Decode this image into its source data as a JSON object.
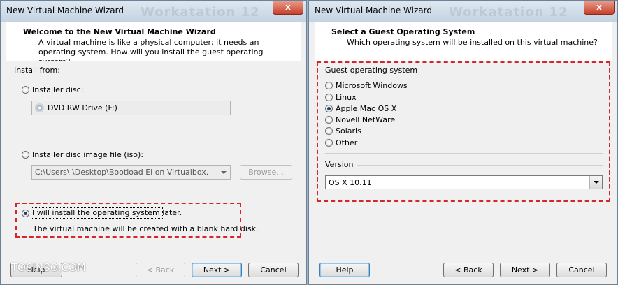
{
  "left_window": {
    "title": "New Virtual Machine Wizard",
    "ghost_title": "Workatation 12",
    "close_label": "x",
    "header": {
      "title": "Welcome to the New Virtual Machine Wizard",
      "subtitle": "A virtual machine is like a physical computer; it needs an operating system. How will you install the guest operating system?"
    },
    "install_from_label": "Install from:",
    "options": {
      "installer_disc": {
        "label": "Installer disc:",
        "checked": false
      },
      "disc_drive_value": "DVD RW Drive (F:)",
      "installer_image": {
        "label": "Installer disc image file (iso):",
        "checked": false
      },
      "iso_path_value": "C:\\Users\\          \\Desktop\\Bootload El on Virtualbox.",
      "browse_label": "Browse...",
      "install_later": {
        "label": "I will install the operating system later.",
        "checked": true
      },
      "install_later_desc": "The virtual machine will be created with a blank hard disk."
    },
    "footer": {
      "help_label": "Help",
      "back_label": "< Back",
      "next_label": "Next >",
      "cancel_label": "Cancel"
    }
  },
  "right_window": {
    "title": "New Virtual Machine Wizard",
    "ghost_title": "Workatation 12",
    "close_label": "x",
    "header": {
      "title": "Select a Guest Operating System",
      "subtitle": "Which operating system will be installed on this virtual machine?"
    },
    "group_label": "Guest operating system",
    "os_options": [
      {
        "label": "Microsoft Windows",
        "checked": false
      },
      {
        "label": "Linux",
        "checked": false
      },
      {
        "label": "Apple Mac OS X",
        "checked": true
      },
      {
        "label": "Novell NetWare",
        "checked": false
      },
      {
        "label": "Solaris",
        "checked": false
      },
      {
        "label": "Other",
        "checked": false
      }
    ],
    "version_label": "Version",
    "version_value": "OS X 10.11",
    "footer": {
      "help_label": "Help",
      "back_label": "< Back",
      "next_label": "Next >",
      "cancel_label": "Cancel"
    }
  },
  "watermark": "TOSINSO.COM",
  "colors": {
    "highlight_dash": "#d3262d",
    "titlebar": "#c3d3e3",
    "window_bg": "#f0f0f0"
  }
}
